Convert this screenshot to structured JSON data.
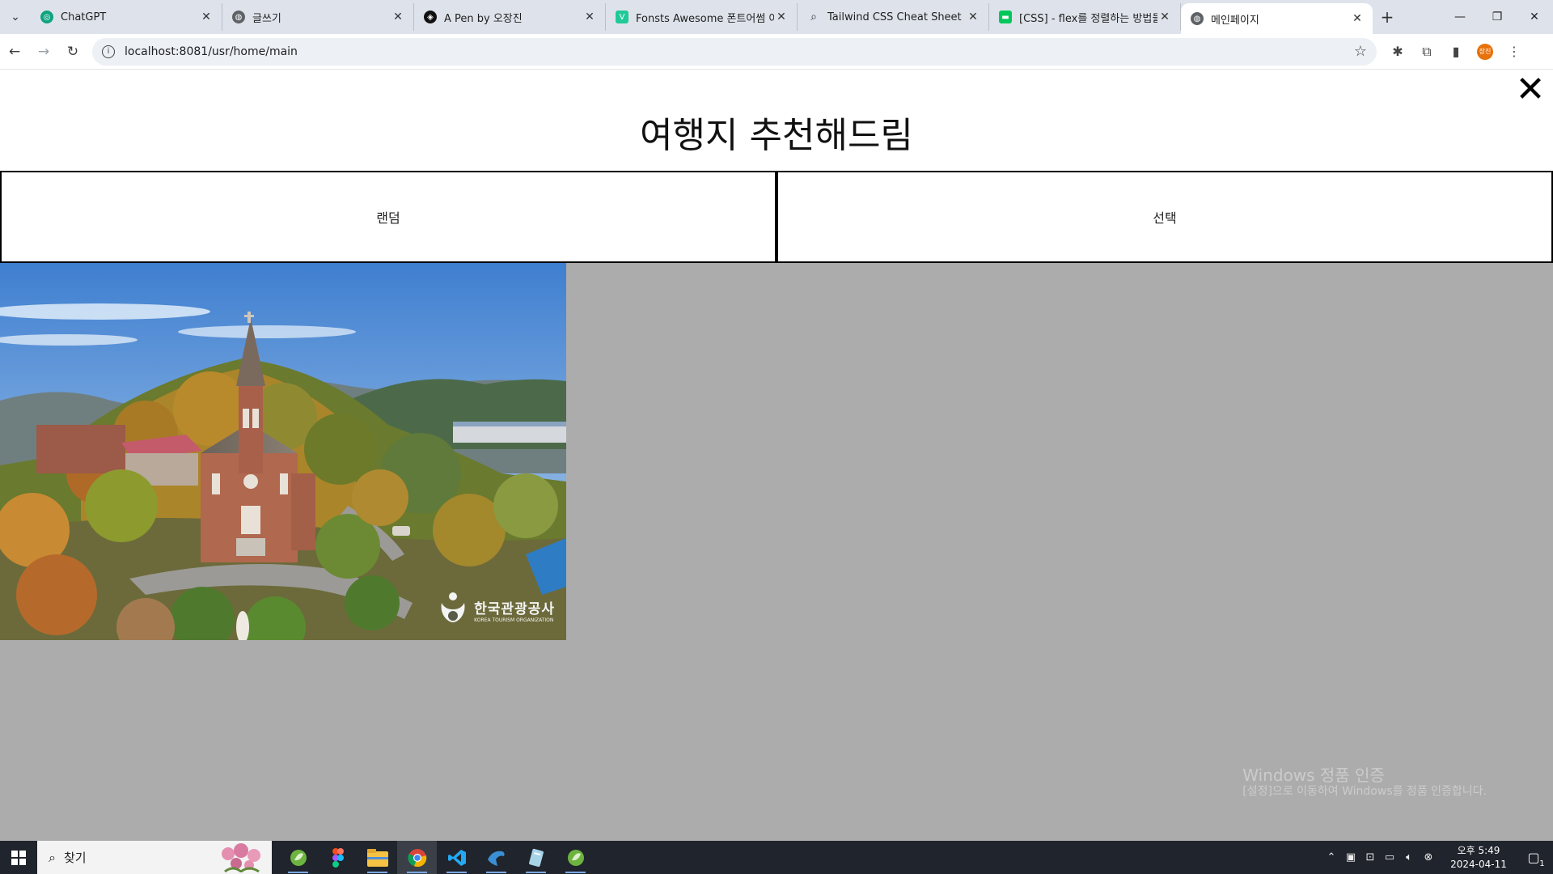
{
  "browser": {
    "tabs": [
      {
        "title": "ChatGPT",
        "icon": "chatgpt-icon",
        "color": "#10a37f"
      },
      {
        "title": "글쓰기",
        "icon": "globe-icon",
        "color": "#5f6368"
      },
      {
        "title": "A Pen by 오장진",
        "icon": "codepen-icon",
        "color": "#111111"
      },
      {
        "title": "Fonsts Awesome 폰트어썸 아이",
        "icon": "velog-icon",
        "color": "#20c997"
      },
      {
        "title": "Tailwind CSS Cheat Sheet",
        "icon": "search-icon",
        "color": "#333333"
      },
      {
        "title": "[CSS] - flex를 정렬하는 방법들",
        "icon": "chat-icon",
        "color": "#03c75a"
      },
      {
        "title": "메인페이지",
        "icon": "globe-icon",
        "color": "#5f6368",
        "active": true
      }
    ],
    "url": "localhost:8081/usr/home/main",
    "profile_label": "장진"
  },
  "page": {
    "title": "여행지 추천해드림",
    "close_label": "✕",
    "buttons": {
      "random": "랜덤",
      "select": "선택"
    },
    "image": {
      "logo_text": "한국관광공사",
      "logo_subtext": "KOREA TOURISM ORGANIZATION"
    },
    "watermark": {
      "line1": "Windows 정품 인증",
      "line2": "[설정]으로 이동하여 Windows를 정품 인증합니다."
    }
  },
  "taskbar": {
    "search_placeholder": "찾기",
    "clock_time": "오후 5:49",
    "clock_date": "2024-04-11",
    "notification_count": "1"
  },
  "colors": {
    "tab_strip": "#dee3eb",
    "result_bg": "#acacac",
    "taskbar": "#20242c"
  }
}
